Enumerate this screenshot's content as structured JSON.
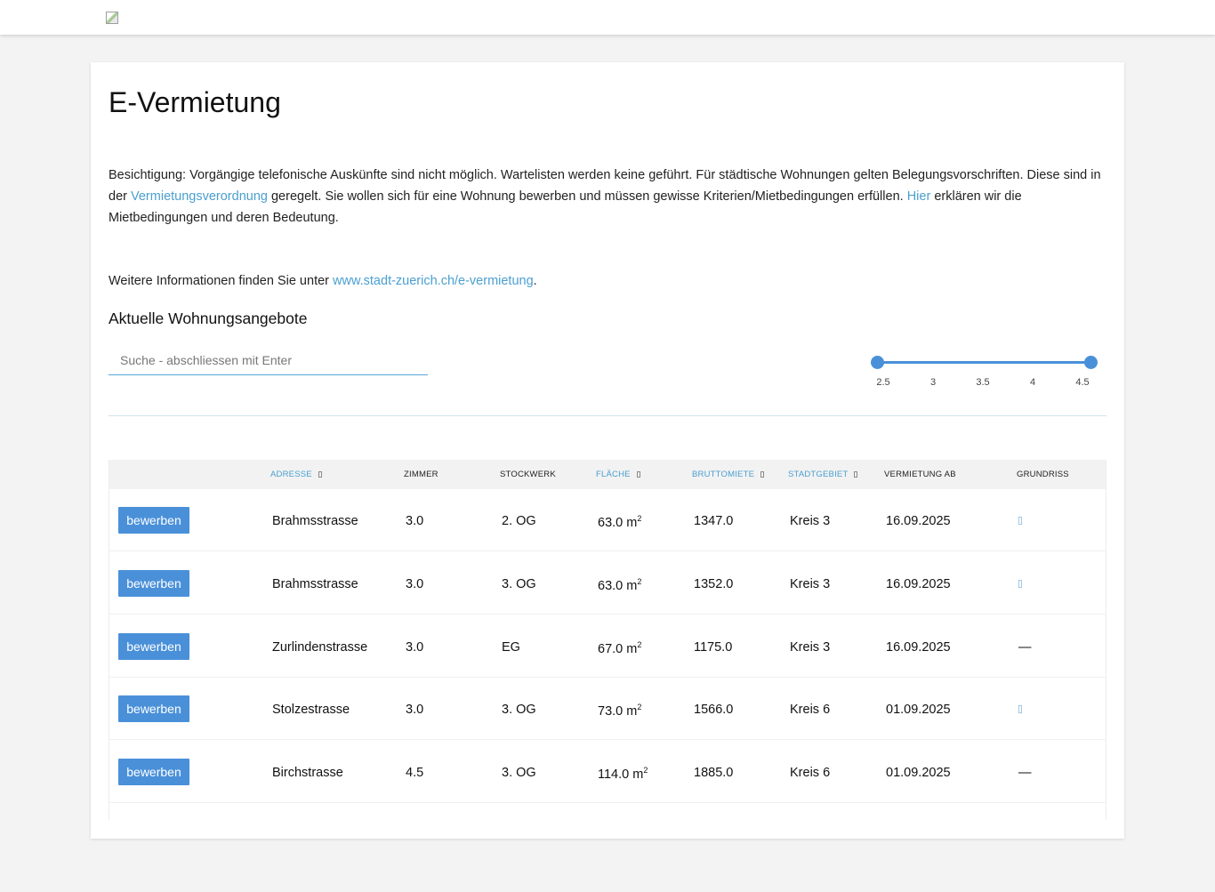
{
  "header": {
    "logo_alt": ""
  },
  "page": {
    "title": "E-Vermietung",
    "intro": {
      "text_1": "Besichtigung: Vorgängige telefonische Auskünfte sind nicht möglich. Wartelisten werden keine geführt. Für städtische Wohnungen gelten Belegungsvorschriften. Diese sind in der ",
      "link_1": "Vermietungsverordnung",
      "text_2": " geregelt. Sie wollen sich für eine Wohnung bewerben und müssen gewisse Kriterien/Mietbedingungen erfüllen. ",
      "link_2": "Hier",
      "text_3": " erklären wir die Mietbedingungen und deren Bedeutung."
    },
    "more_info": {
      "text": "Weitere Informationen finden Sie unter ",
      "link": "www.stadt-zuerich.ch/e-vermietung",
      "suffix": "."
    },
    "section_title": "Aktuelle Wohnungsangebote"
  },
  "search": {
    "placeholder": "Suche - abschliessen mit Enter",
    "value": ""
  },
  "room_filter": {
    "min": 2.5,
    "max": 4.5,
    "selected_min": 2.5,
    "selected_max": 4.5,
    "ticks": [
      "2.5",
      "3",
      "3.5",
      "4",
      "4.5"
    ],
    "color": "#4a90d9"
  },
  "table": {
    "columns": {
      "address": "Adresse",
      "rooms": "Zimmer",
      "floor": "Stockwerk",
      "area": "Fläche",
      "rent": "Bruttomiete",
      "district": "Stadtgebiet",
      "available": "Vermietung ab",
      "plan": "Grundriss"
    },
    "sortable_columns": [
      "Adresse",
      "Fläche",
      "Bruttomiete",
      "Stadtgebiet"
    ],
    "apply_label": "bewerben",
    "area_unit": "m",
    "area_unit_exp": "2",
    "rows": [
      {
        "address": "Brahmsstrasse",
        "rooms": "3.0",
        "floor": "2. OG",
        "area": "63.0",
        "rent": "1347.0",
        "district": "Kreis 3",
        "available": "16.09.2025",
        "plan": "file-icon"
      },
      {
        "address": "Brahmsstrasse",
        "rooms": "3.0",
        "floor": "3. OG",
        "area": "63.0",
        "rent": "1352.0",
        "district": "Kreis 3",
        "available": "16.09.2025",
        "plan": "file-icon"
      },
      {
        "address": "Zurlindenstrasse",
        "rooms": "3.0",
        "floor": "EG",
        "area": "67.0",
        "rent": "1175.0",
        "district": "Kreis 3",
        "available": "16.09.2025",
        "plan": "—"
      },
      {
        "address": "Stolzestrasse",
        "rooms": "3.0",
        "floor": "3. OG",
        "area": "73.0",
        "rent": "1566.0",
        "district": "Kreis 6",
        "available": "01.09.2025",
        "plan": "file-icon"
      },
      {
        "address": "Birchstrasse",
        "rooms": "4.5",
        "floor": "3. OG",
        "area": "114.0",
        "rent": "1885.0",
        "district": "Kreis 6",
        "available": "01.09.2025",
        "plan": "—"
      }
    ]
  },
  "colors": {
    "accent": "#4a90d9",
    "link": "#4a9fd0",
    "background": "#f3f3f3"
  }
}
